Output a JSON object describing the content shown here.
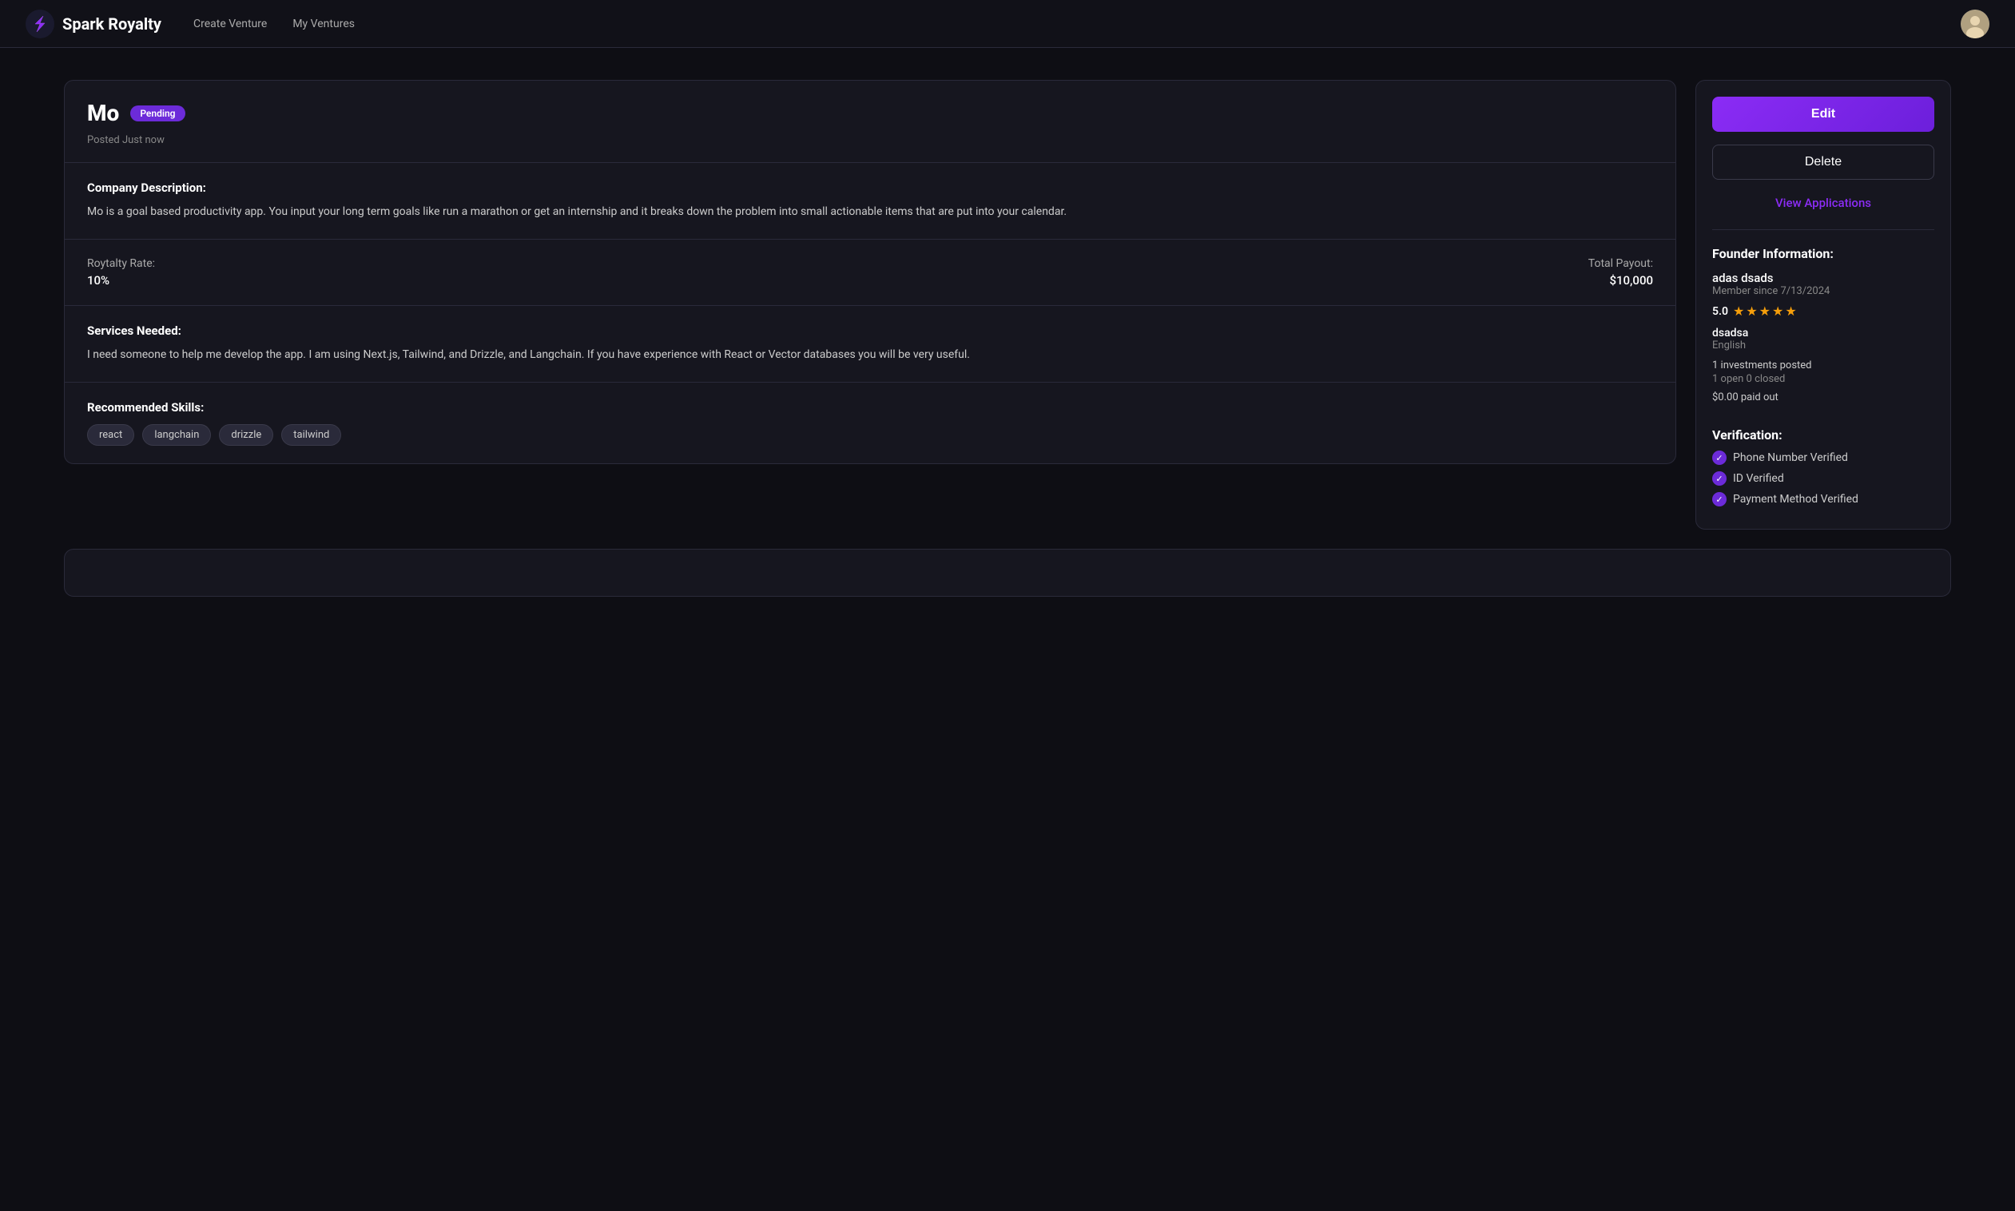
{
  "nav": {
    "logo_text": "Spark Royalty",
    "links": [
      "Create Venture",
      "My Ventures"
    ],
    "avatar_emoji": "👤"
  },
  "venture": {
    "title": "Mo",
    "badge": "Pending",
    "posted": "Posted Just now",
    "sections": {
      "company_description_title": "Company Description:",
      "company_description_text": "Mo is a goal based productivity app. You input your long term goals like run a marathon or get an internship and it breaks down the problem into small actionable items that are put into your calendar.",
      "royalty_rate_label": "Roytalty Rate:",
      "royalty_rate_value": "10%",
      "total_payout_label": "Total Payout:",
      "total_payout_value": "$10,000",
      "services_title": "Services Needed:",
      "services_text": "I need someone to help me develop the app. I am using Next.js, Tailwind, and Drizzle, and Langchain. If you have experience with React or Vector databases you will be very useful.",
      "skills_title": "Recommended Skills:",
      "skills": [
        "react",
        "langchain",
        "drizzle",
        "tailwind"
      ]
    }
  },
  "sidebar": {
    "edit_label": "Edit",
    "delete_label": "Delete",
    "view_applications_label": "View Applications",
    "founder_heading": "Founder Information:",
    "founder_name": "adas dsads",
    "member_since": "Member since 7/13/2024",
    "rating": "5.0",
    "stars_count": 5,
    "username": "dsadsa",
    "language": "English",
    "investments_posted": "1 investments posted",
    "investments_status": "1 open 0 closed",
    "paid_out": "$0.00 paid out",
    "verification_heading": "Verification:",
    "verifications": [
      "Phone Number Verified",
      "ID Verified",
      "Payment Method Verified"
    ]
  }
}
